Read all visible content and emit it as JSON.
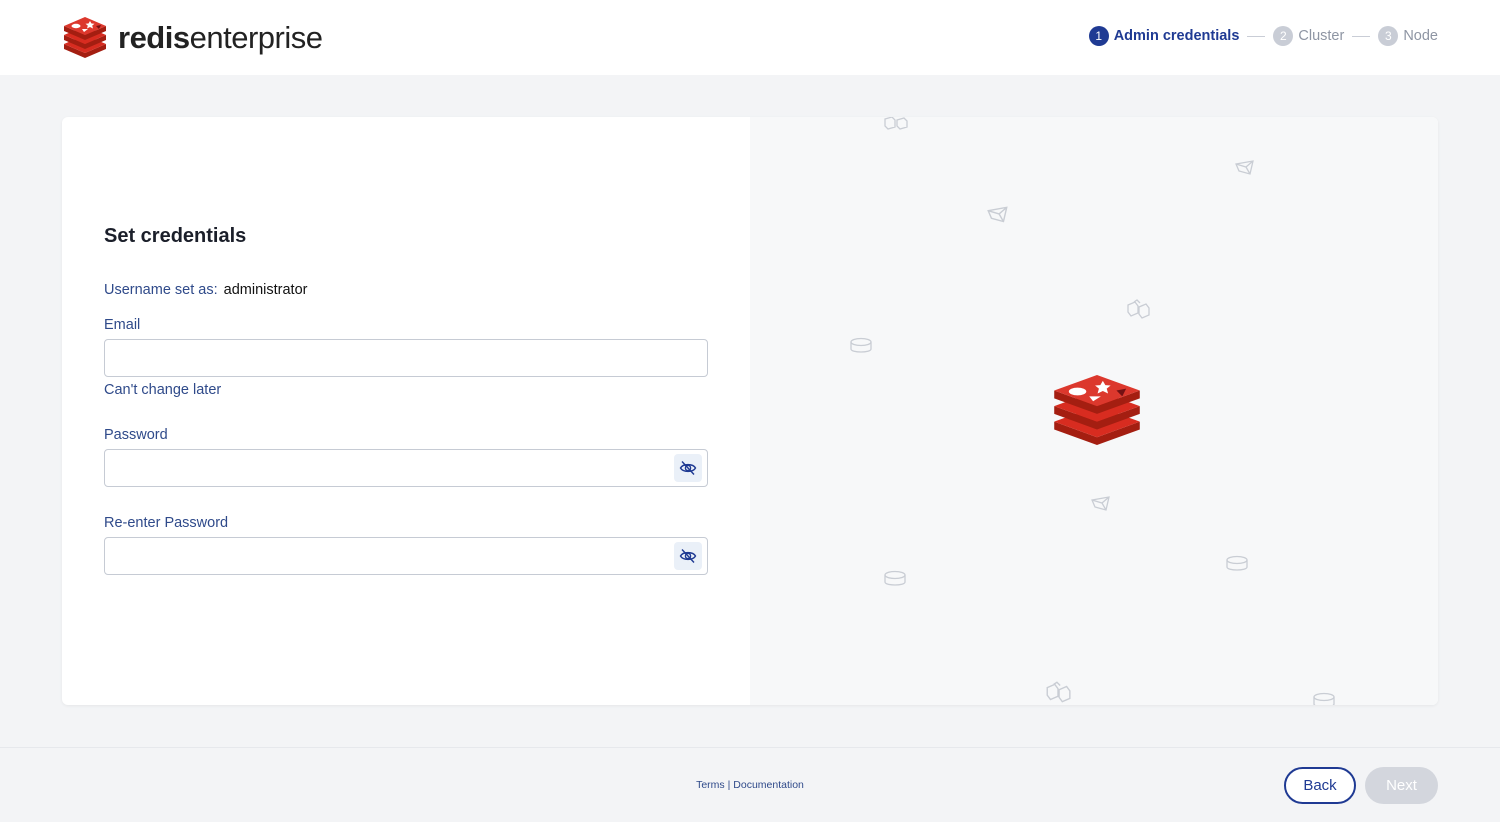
{
  "brand": {
    "name_bold": "redis",
    "name_light": "enterprise",
    "logo_icon": "redis-cube-logo",
    "accent_color": "#dc382d"
  },
  "stepper": {
    "steps": [
      {
        "number": "1",
        "label": "Admin credentials",
        "state": "active"
      },
      {
        "number": "2",
        "label": "Cluster",
        "state": "inactive"
      },
      {
        "number": "3",
        "label": "Node",
        "state": "inactive"
      }
    ],
    "active_color": "#1f3a93"
  },
  "form": {
    "title": "Set credentials",
    "username_label": "Username set as:",
    "username_value": "administrator",
    "email": {
      "label": "Email",
      "value": "",
      "placeholder": "",
      "help": "Can't change later"
    },
    "password": {
      "label": "Password",
      "value": "",
      "placeholder": "",
      "toggle_icon": "eye-slash-icon"
    },
    "reenter_password": {
      "label": "Re-enter Password",
      "value": "",
      "placeholder": "",
      "toggle_icon": "eye-slash-icon"
    }
  },
  "footer": {
    "terms": "Terms",
    "separator": "|",
    "documentation": "Documentation",
    "back_label": "Back",
    "next_label": "Next"
  }
}
